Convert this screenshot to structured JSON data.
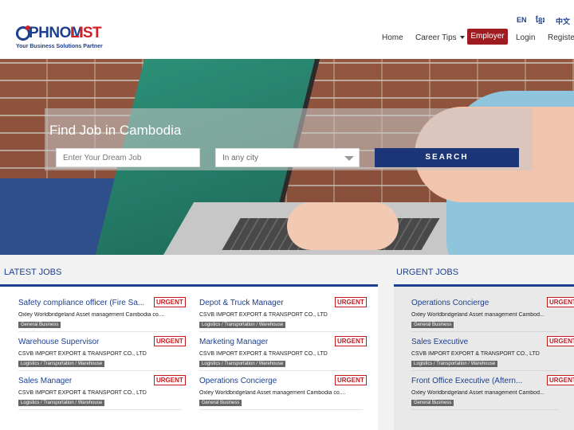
{
  "header": {
    "logo": {
      "part1": "PHNOM",
      "part2": "LIST",
      "tagline": "Your Business Solutions Partner"
    },
    "languages": [
      "EN",
      "ខ្មែរ",
      "中文"
    ],
    "nav": {
      "home": "Home",
      "career_tips": "Career Tips",
      "employer": "Employer",
      "login": "Login",
      "register": "Register"
    }
  },
  "hero": {
    "title": "Find Job in Cambodia",
    "search_placeholder": "Enter Your Dream Job",
    "city_value": "In any city",
    "search_button": "SEARCH"
  },
  "latest": {
    "title": "LATEST JOBS",
    "jobs": [
      {
        "title": "Safety compliance officer (Fire Sa...",
        "company": "Oxley Worldbridgeland Asset management Cambodia co....",
        "category": "General Business",
        "badge": "URGENT"
      },
      {
        "title": "Depot & Truck Manager",
        "company": "CSVB IMPORT EXPORT & TRANSPORT CO., LTD",
        "category": "Logistics / Transportation / Warehouse",
        "badge": "URGENT"
      },
      {
        "title": "Warehouse Supervisor",
        "company": "CSVB IMPORT EXPORT & TRANSPORT CO., LTD",
        "category": "Logistics / Transportation / Warehouse",
        "badge": "URGENT"
      },
      {
        "title": "Marketing Manager",
        "company": "CSVB IMPORT EXPORT & TRANSPORT CO., LTD",
        "category": "Logistics / Transportation / Warehouse",
        "badge": "URGENT"
      },
      {
        "title": "Sales Manager",
        "company": "CSVB IMPORT EXPORT & TRANSPORT CO., LTD",
        "category": "Logistics / Transportation / Warehouse",
        "badge": "URGENT"
      },
      {
        "title": "Operations Concierge",
        "company": "Oxley Worldbridgeland Asset management Cambodia co....",
        "category": "General Business",
        "badge": "URGENT"
      }
    ]
  },
  "urgent": {
    "title": "URGENT JOBS",
    "jobs": [
      {
        "title": "Operations Concierge",
        "company": "Oxley Worldbridgeland Asset management Cambod...",
        "category": "General Business",
        "badge": "URGENT"
      },
      {
        "title": "Sales Executive",
        "company": "CSVB IMPORT EXPORT & TRANSPORT CO., LTD",
        "category": "Logistics / Transportation / Warehouse",
        "badge": "URGENT"
      },
      {
        "title": "Front Office Executive (Aftern...",
        "company": "Oxley Worldbridgeland Asset management Cambod...",
        "category": "General Business",
        "badge": "URGENT"
      }
    ]
  },
  "colors": {
    "brand_blue": "#1c3f8f",
    "brand_red": "#d02127",
    "employer_button": "#9e1c1f",
    "search_button": "#1c3577"
  }
}
